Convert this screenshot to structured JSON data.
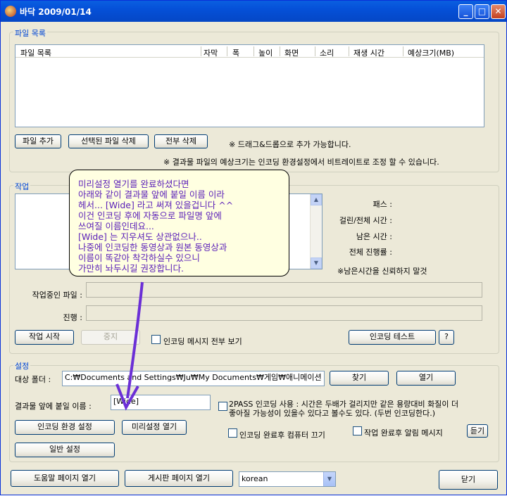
{
  "window": {
    "title": "바닥 2009/01/14"
  },
  "file_list": {
    "group_label": "파일 목록",
    "columns": [
      "파일 목록",
      "자막",
      "폭",
      "높이",
      "화면",
      "소리",
      "재생 시간",
      "예상크기(MB)"
    ],
    "add_button": "파일 추가",
    "delete_selected_button": "선택된 파일 삭제",
    "delete_all_button": "전부 삭제",
    "drag_note": "※ 드래그&드롭으로 추가 가능합니다.",
    "size_note": "※ 결과물 파일의 예상크기는 인코딩 환경설정에서 비트레이트로 조정 할 수 있습니다."
  },
  "work": {
    "group_label": "작업",
    "pass_label": "패스 :",
    "elapsed_label": "걸린/전체 시간 :",
    "remaining_label": "남은 시간 :",
    "progress_label": "전체 진행률 :",
    "remaining_note": "※남은시간을 신뢰하지 말것",
    "current_file_label": "작업중인 파일 :",
    "progress_row_label": "진행 :",
    "start_button": "작업 시작",
    "stop_button": "중지",
    "show_all_messages_label": "인코딩 메시지 전부 보기",
    "test_button": "인코딩 테스트",
    "help_button": "?"
  },
  "callout": {
    "lines": [
      "미리설정 열기를 완료하셨다면",
      "아래와 같이 결과물 앞에 붙일 이름 이라",
      "헤서... [Wide] 라고 써져 있을겁니다 ^^",
      "이건 인코딩 후에 자동으로 파일명 앞에",
      "쓰여질 이름인데요...",
      "[Wide] 는 지우셔도 상관없으나..",
      "나중에 인코딩한 동영상과 원본 동영상과",
      "이름이 똑같아 착각하실수 있으니",
      "가만히 놔두시길 권장합니다."
    ]
  },
  "settings": {
    "group_label": "설정",
    "target_folder_label": "대상 폴더 :",
    "target_folder_value": "C:₩Documents and Settings₩Ju₩My Documents₩게임₩애니메이션",
    "find_button": "찾기",
    "open_button": "열기",
    "prefix_label": "결과물 앞에 붙일 이름 :",
    "prefix_value": "[Wide]",
    "two_pass_line1": "2PASS 인코딩 사용 : 시간은 두배가 걸리지만 같은 용량대비 화질이 더",
    "two_pass_line2": "좋아질 가능성이 있을수 있다고 볼수도 있다. (두번 인코딩한다.)",
    "encoding_env_button": "인코딩 환경 설정",
    "preset_open_button": "미리설정 열기",
    "shutdown_label": "인코딩 완료후 컴퓨터 끄기",
    "alarm_label": "작업 완료후 알림 메시지",
    "listen_button": "듣기",
    "general_button": "일반 설정"
  },
  "footer": {
    "help_page_button": "도움말 페이지 열기",
    "board_page_button": "게시판 페이지 열기",
    "language_value": "korean",
    "close_button": "닫기"
  },
  "colors": {
    "annotation": "#6b2fd6",
    "callout_text": "#5a1fb8",
    "title_bar": "#0550d8"
  }
}
